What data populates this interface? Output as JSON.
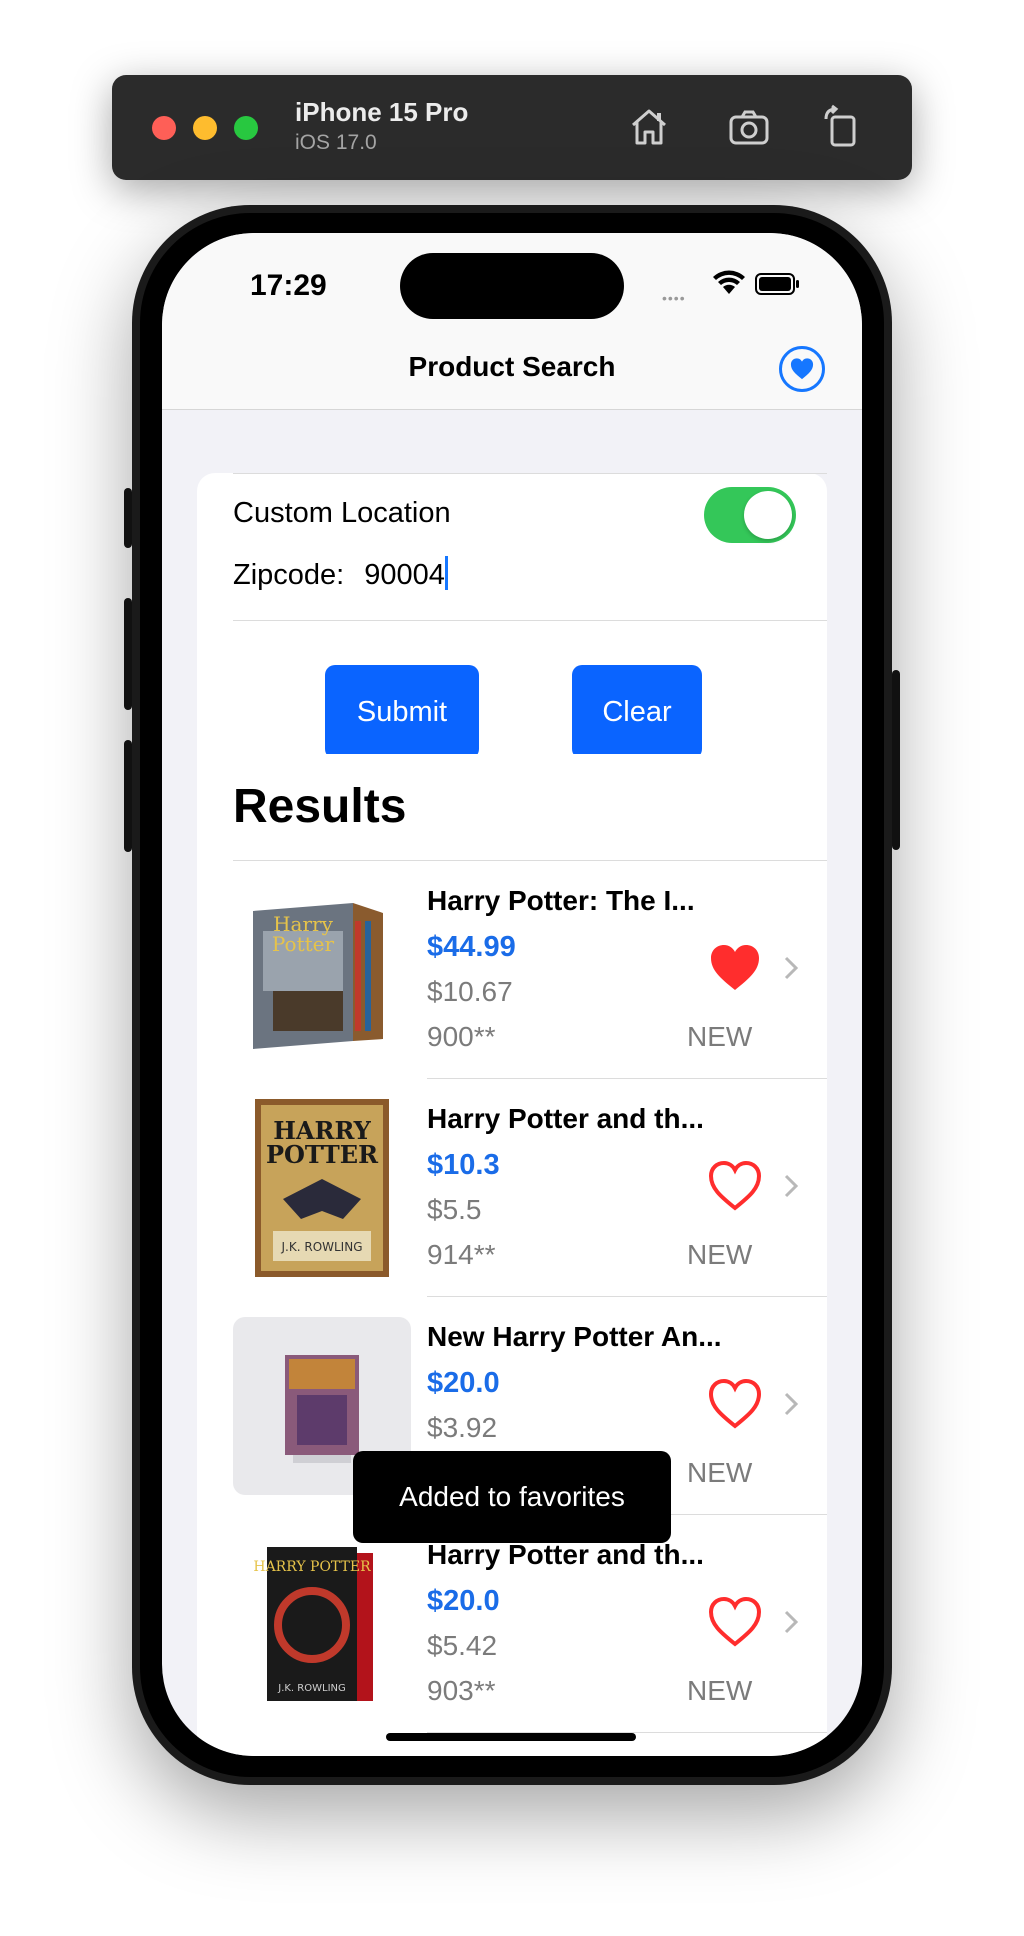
{
  "simulator": {
    "device_name": "iPhone 15 Pro",
    "os_version": "iOS 17.0",
    "icons": [
      "home-icon",
      "screenshot-icon",
      "rotate-icon"
    ]
  },
  "status_bar": {
    "time": "17:29",
    "signal_dots": "••••"
  },
  "navbar": {
    "title": "Product Search",
    "favorites_icon": "heart-circle-icon",
    "accent": "#1677ff"
  },
  "form": {
    "custom_location_label": "Custom Location",
    "custom_location_on": true,
    "zipcode_label": "Zipcode:",
    "zipcode_value": "90004",
    "submit_label": "Submit",
    "clear_label": "Clear",
    "button_color": "#0a64ff",
    "toggle_color": "#34c759"
  },
  "results": {
    "heading": "Results",
    "items": [
      {
        "title": "Harry Potter: The I...",
        "price": "$44.99",
        "shipping": "$10.67",
        "zip": "900**",
        "condition": "NEW",
        "favorited": true
      },
      {
        "title": "Harry Potter and th...",
        "price": "$10.3",
        "shipping": "$5.5",
        "zip": "914**",
        "condition": "NEW",
        "favorited": false
      },
      {
        "title": "New Harry Potter An...",
        "price": "$20.0",
        "shipping": "$3.92",
        "zip": "",
        "condition": "NEW",
        "favorited": false
      },
      {
        "title": "Harry Potter and th...",
        "price": "$20.0",
        "shipping": "$5.42",
        "zip": "903**",
        "condition": "NEW",
        "favorited": false
      }
    ],
    "price_color": "#1a6ce8",
    "heart_color": "#ff2d2d"
  },
  "toast": {
    "message": "Added to favorites"
  }
}
